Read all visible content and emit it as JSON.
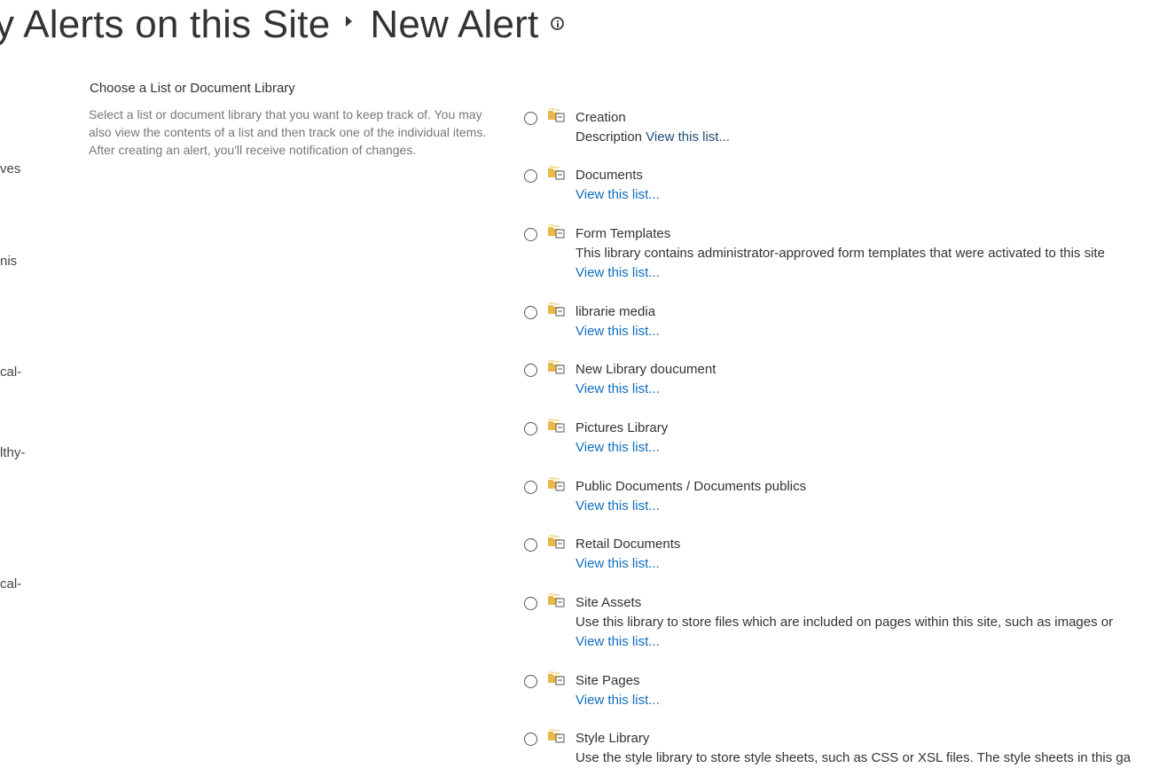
{
  "header": {
    "title_left": "y Alerts on this Site",
    "title_right": "New Alert"
  },
  "nav_fragments": [
    "ves",
    "nis",
    "cal-",
    "lthy-",
    "cal-"
  ],
  "section": {
    "title": "Choose a List or Document Library",
    "description": "Select a list or document library that you want to keep track of. You may also view the contents of a list and then track one of the individual items. After creating an alert, you'll receive notification of changes."
  },
  "libraries": [
    {
      "name": "Creation",
      "description_prefix": "Description",
      "link": "View this list..."
    },
    {
      "name": "Documents",
      "description": "",
      "link": "View this list..."
    },
    {
      "name": "Form Templates",
      "description": "This library contains administrator-approved form templates that were activated to this site",
      "link": "View this list..."
    },
    {
      "name": "librarie media",
      "description": "",
      "link": "View this list..."
    },
    {
      "name": "New Library doucument",
      "description": "",
      "link": "View this list..."
    },
    {
      "name": "Pictures Library",
      "description": "",
      "link": "View this list..."
    },
    {
      "name": "Public Documents / Documents publics",
      "description": "",
      "link": "View this list..."
    },
    {
      "name": "Retail Documents",
      "description": "",
      "link": "View this list..."
    },
    {
      "name": "Site Assets",
      "description": "Use this library to store files which are included on pages within this site, such as images or",
      "link": "View this list..."
    },
    {
      "name": "Site Pages",
      "description": "",
      "link": "View this list..."
    },
    {
      "name": "Style Library",
      "description": "Use the style library to store style sheets, such as CSS or XSL files. The style sheets in this ga",
      "link": ""
    }
  ],
  "colors": {
    "link": "#106ebe",
    "text": "#333333",
    "muted": "#777777",
    "icon_folder": "#e8b84a"
  },
  "icons": {
    "library": "document-library-icon",
    "info": "info-icon",
    "breadcrumb": "breadcrumb-arrow-icon"
  }
}
